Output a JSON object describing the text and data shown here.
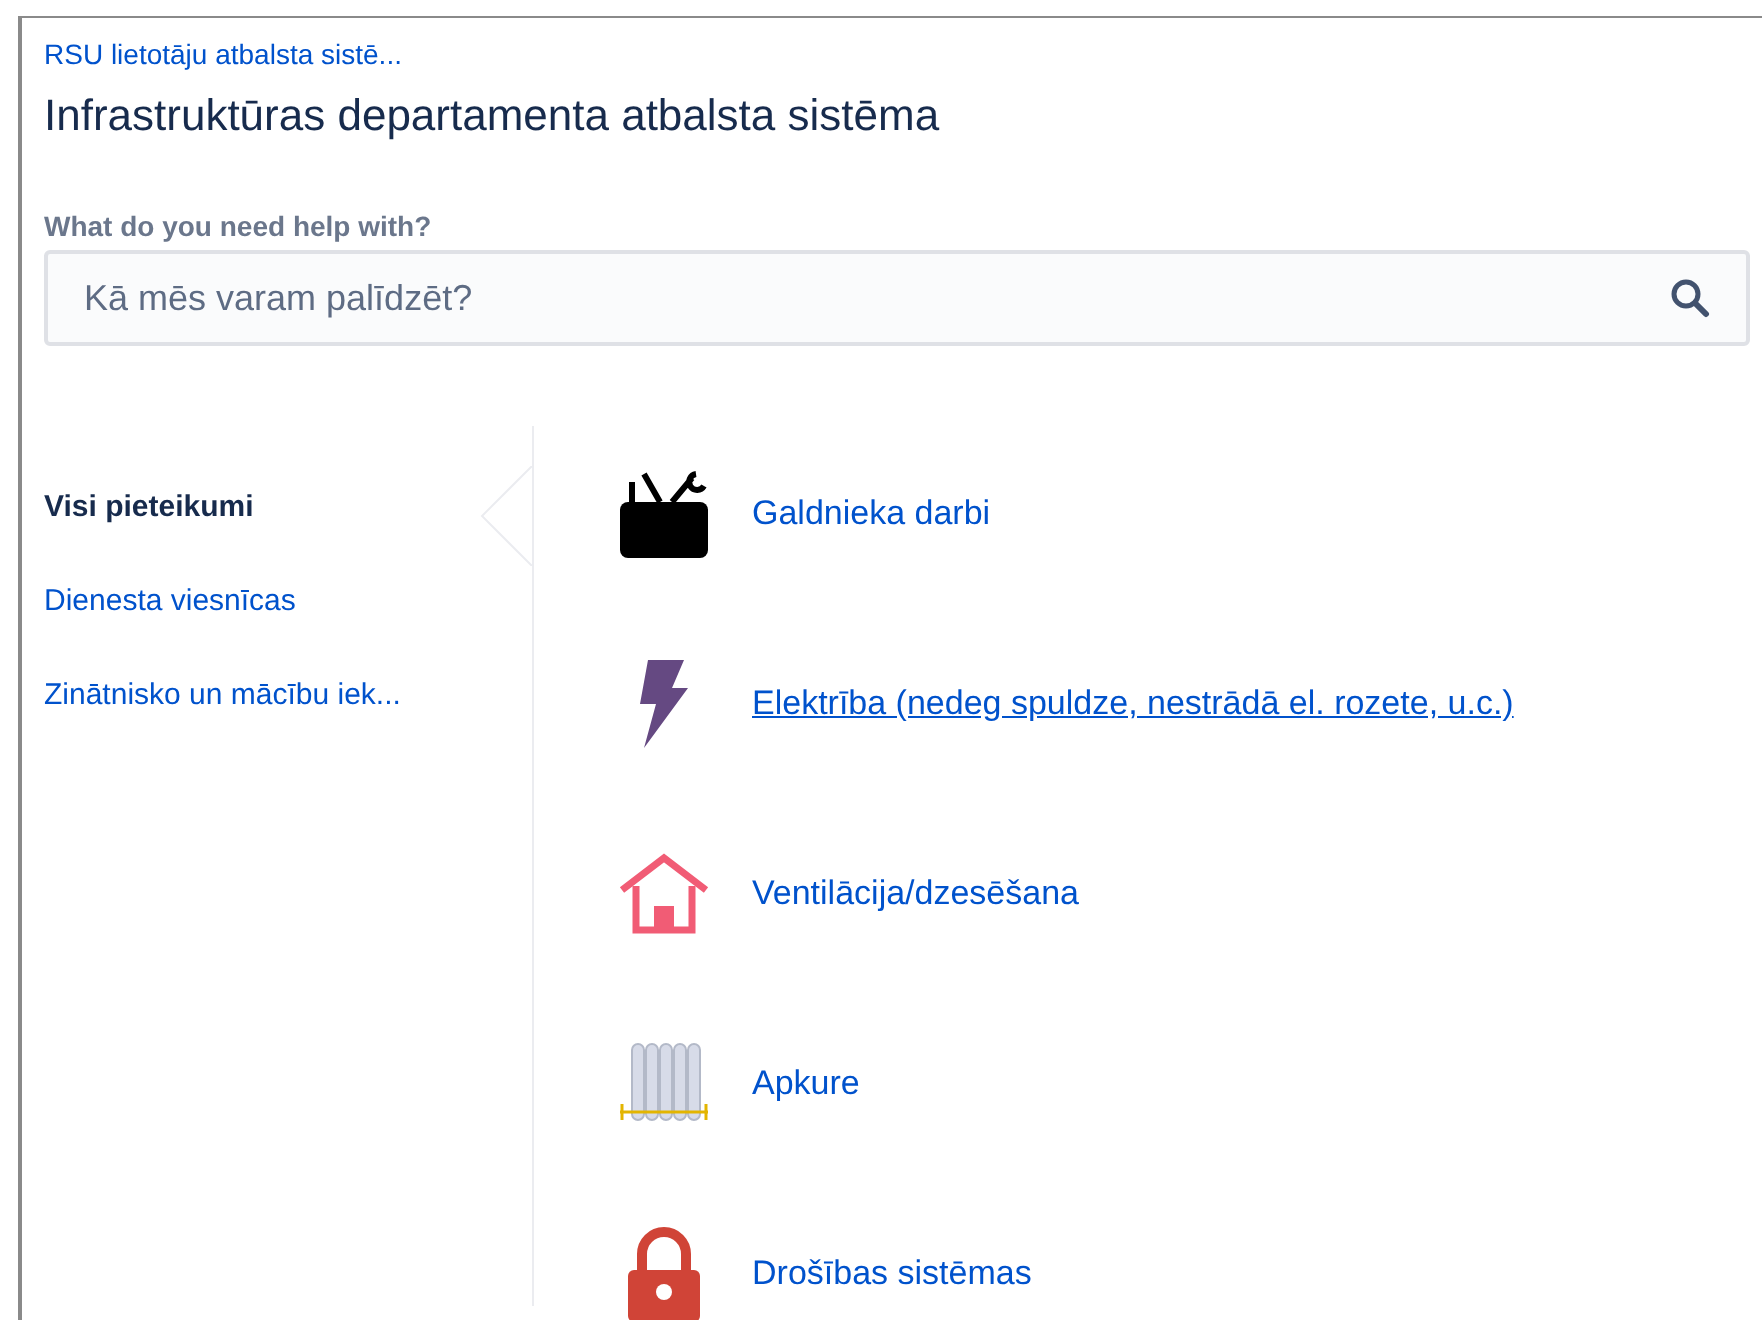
{
  "breadcrumb": "RSU lietotāju atbalsta sistē...",
  "title": "Infrastruktūras departamenta atbalsta sistēma",
  "search": {
    "label": "What do you need help with?",
    "placeholder": "Kā mēs varam palīdzēt?"
  },
  "sidebar": {
    "items": [
      {
        "label": "Visi pieteikumi",
        "selected": true
      },
      {
        "label": "Dienesta viesnīcas",
        "selected": false
      },
      {
        "label": "Zinātnisko un mācību iek...",
        "selected": false
      }
    ]
  },
  "request_types": [
    {
      "kind": "toolbox",
      "label": "Galdnieka darbi",
      "hovered": false
    },
    {
      "kind": "bolt",
      "label": "Elektrība (nedeg spuldze, nestrādā el. rozete, u.c.)",
      "hovered": true
    },
    {
      "kind": "house",
      "label": "Ventilācija/dzesēšana",
      "hovered": false
    },
    {
      "kind": "radiator",
      "label": "Apkure",
      "hovered": false
    },
    {
      "kind": "lock",
      "label": "Drošības sistēmas",
      "hovered": false
    }
  ]
}
